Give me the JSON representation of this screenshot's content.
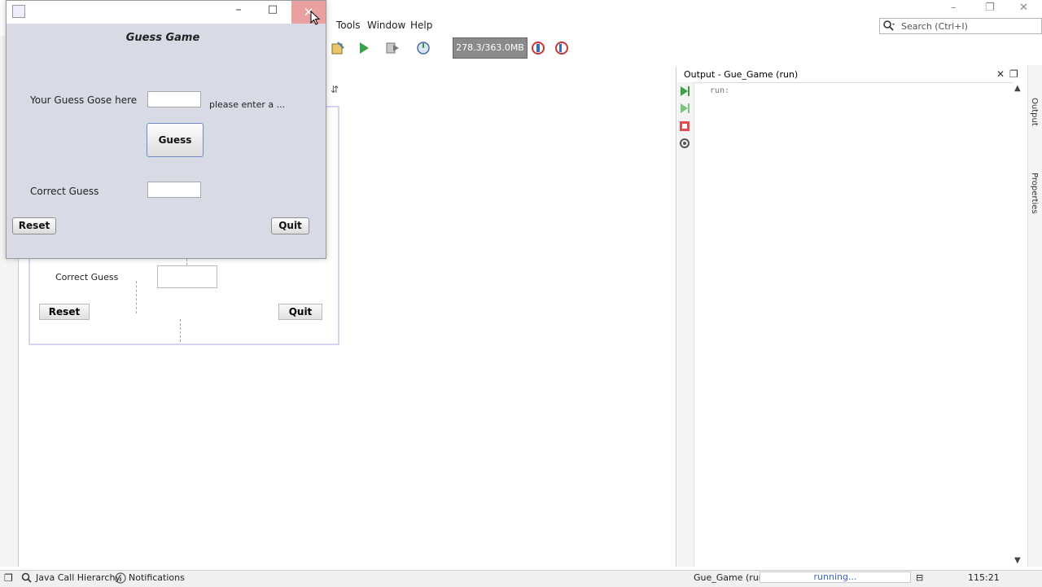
{
  "ide": {
    "menu": {
      "tools": "Tools",
      "window": "Window",
      "help": "Help"
    },
    "memory": "278.3/363.0MB",
    "search_placeholder": "Search (Ctrl+I)",
    "colors": {
      "accent": "#3b66c9",
      "close_hover": "#e8a0a0"
    }
  },
  "designer": {
    "correct_label": "Correct Guess",
    "reset_label": "Reset",
    "quit_label": "Quit"
  },
  "output": {
    "title": "Output - Gue_Game (run)",
    "text": "run:",
    "vertical_tabs": [
      "Output",
      "Properties"
    ]
  },
  "status": {
    "java_call_hierarchy": "Java Call Hierarchy",
    "notifications": "Notifications",
    "task": "Gue_Game (run)",
    "progress": "running...",
    "position": "115:21"
  },
  "game": {
    "title": "Guess Game",
    "guess_label": "Your Guess Gose here",
    "hint": "please enter a ...",
    "guess_button": "Guess",
    "correct_label": "Correct Guess",
    "reset_button": "Reset",
    "quit_button": "Quit",
    "guess_value": "",
    "correct_value": ""
  }
}
